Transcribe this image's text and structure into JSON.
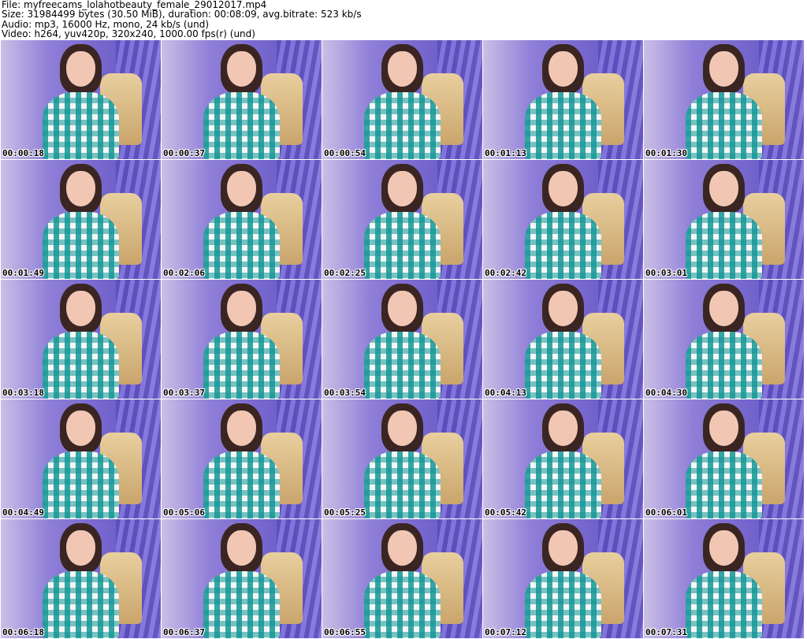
{
  "header": {
    "file_line": "File: myfreecams_lolahotbeauty_female_29012017.mp4",
    "size_line": "Size: 31984499 bytes (30.50 MiB), duration: 00:08:09, avg.bitrate: 523 kb/s",
    "audio_line": "Audio: mp3, 16000 Hz, mono, 24 kb/s (und)",
    "video_line": "Video: h264, yuv420p, 320x240, 1000.00 fps(r) (und)"
  },
  "thumbnails": [
    "00:00:18",
    "00:00:37",
    "00:00:54",
    "00:01:13",
    "00:01:30",
    "00:01:49",
    "00:02:06",
    "00:02:25",
    "00:02:42",
    "00:03:01",
    "00:03:18",
    "00:03:37",
    "00:03:54",
    "00:04:13",
    "00:04:30",
    "00:04:49",
    "00:05:06",
    "00:05:25",
    "00:05:42",
    "00:06:01",
    "00:06:18",
    "00:06:37",
    "00:06:55",
    "00:07:12",
    "00:07:31"
  ]
}
